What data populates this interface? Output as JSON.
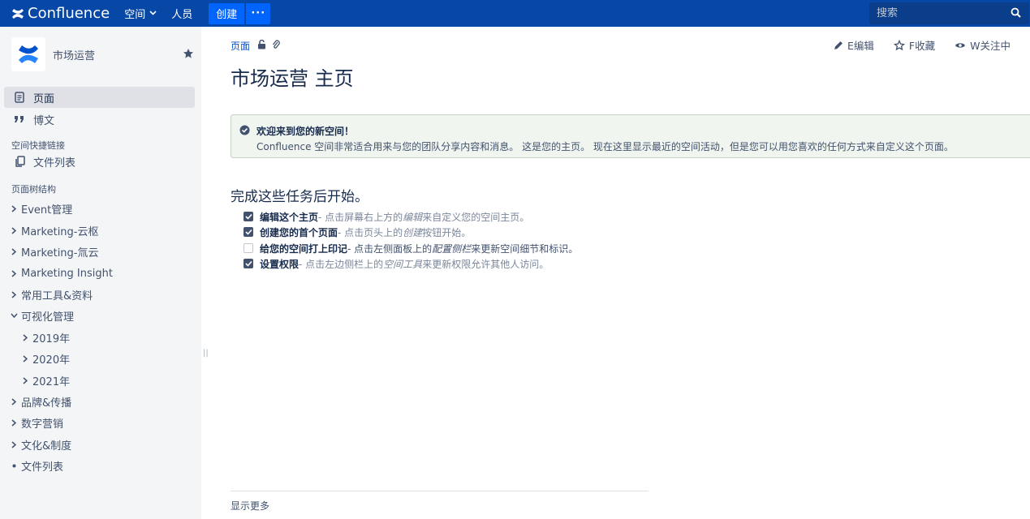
{
  "topbar": {
    "app_name": "Confluence",
    "nav": [
      {
        "label": "空间"
      },
      {
        "label": "人员"
      }
    ],
    "create_label": "创建",
    "more_label": "···",
    "search_placeholder": "搜索"
  },
  "sidebar": {
    "space_name": "市场运营",
    "links": [
      {
        "label": "页面"
      },
      {
        "label": "博文"
      }
    ],
    "shortcuts_label": "空间快捷链接",
    "shortcut": {
      "label": "文件列表"
    },
    "tree_label": "页面树结构",
    "tree": [
      {
        "label": "Event管理"
      },
      {
        "label": "Marketing-云枢"
      },
      {
        "label": "Marketing-氚云"
      },
      {
        "label": "Marketing Insight"
      },
      {
        "label": "常用工具&资料"
      },
      {
        "label": "可视化管理"
      },
      {
        "label": "2019年"
      },
      {
        "label": "2020年"
      },
      {
        "label": "2021年"
      },
      {
        "label": "品牌&传播"
      },
      {
        "label": "数字营销"
      },
      {
        "label": "文化&制度"
      },
      {
        "label": "文件列表"
      }
    ]
  },
  "main": {
    "breadcrumb": "页面",
    "actions": {
      "edit": "E编辑",
      "favorite": "F收藏",
      "watch": "W关注中"
    },
    "title": "市场运营 主页",
    "info": {
      "title": "欢迎来到您的新空间！",
      "body": "Confluence 空间非常适合用来与您的团队分享内容和消息。 这是您的主页。 现在这里显示最近的空间活动，但是您可以用您喜欢的任何方式来自定义这个页面。"
    },
    "tasks_title": "完成这些任务后开始。",
    "tasks": [
      {
        "bold": "编辑这个主页",
        "pre": " - 点击屏幕右上方的",
        "em": "编辑",
        "post": "来自定义您的空间主页。",
        "checked": true
      },
      {
        "bold": "创建您的首个页面",
        "pre": " - 点击页头上的",
        "em": "创建",
        "post": "按钮开始。",
        "checked": true
      },
      {
        "bold": "给您的空间打上印记",
        "pre": " - 点击左侧面板上的",
        "em": "配置侧栏",
        "post": "来更新空间细节和标识。",
        "checked": false
      },
      {
        "bold": "设置权限",
        "pre": " - 点击左边侧栏上的",
        "em": "空间工具",
        "post": "来更新权限允许其他人访问。",
        "checked": true
      }
    ],
    "show_more": "显示更多"
  }
}
